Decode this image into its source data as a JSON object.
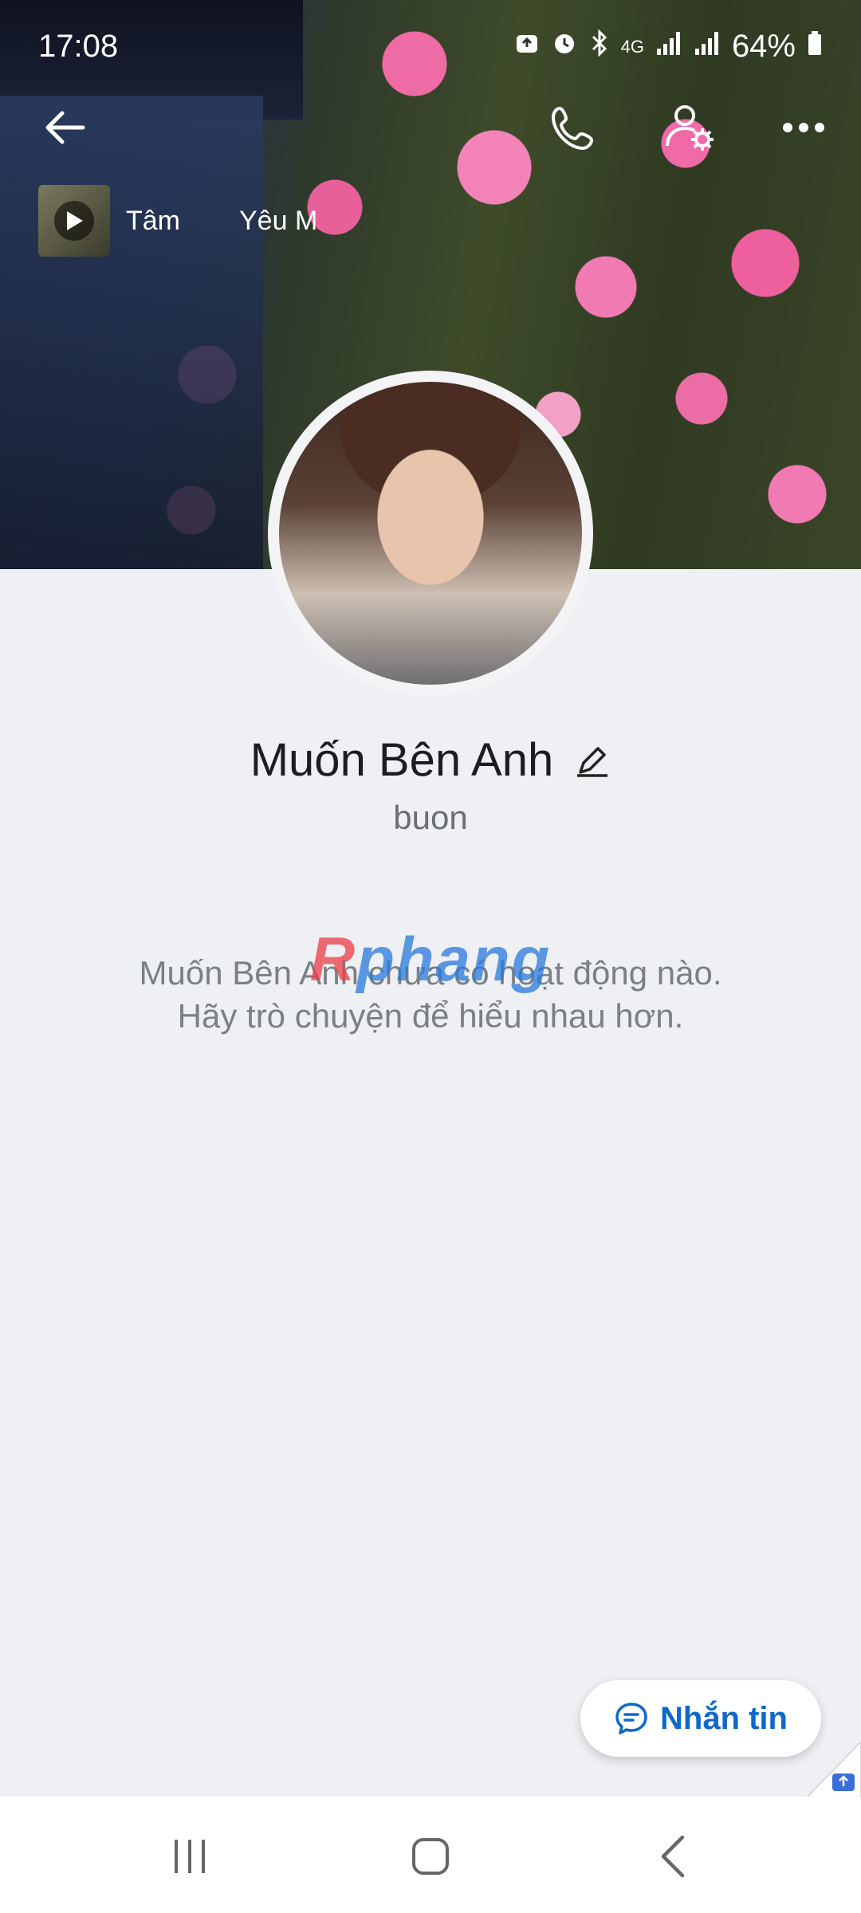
{
  "status_bar": {
    "time": "17:08",
    "network": "4G",
    "battery": "64%"
  },
  "profile": {
    "name": "Muốn Bên Anh",
    "subtitle": "buon",
    "empty_line1": "Muốn Bên Anh chưa có hoạt động nào.",
    "empty_line2": "Hãy trò chuyện để hiểu nhau hơn."
  },
  "music": {
    "ticker_items": [
      "Tâm",
      "Yêu M"
    ]
  },
  "watermark": {
    "part1": "R",
    "part2": "phang"
  },
  "actions": {
    "message_label": "Nhắn tin"
  },
  "icons": {
    "back": "arrow-left-icon",
    "call": "phone-icon",
    "settings": "user-settings-icon",
    "more": "more-dots-icon",
    "edit": "pencil-icon",
    "chat": "chat-bubble-icon"
  },
  "colors": {
    "background": "#eff0f4",
    "accent": "#0d68c9"
  }
}
